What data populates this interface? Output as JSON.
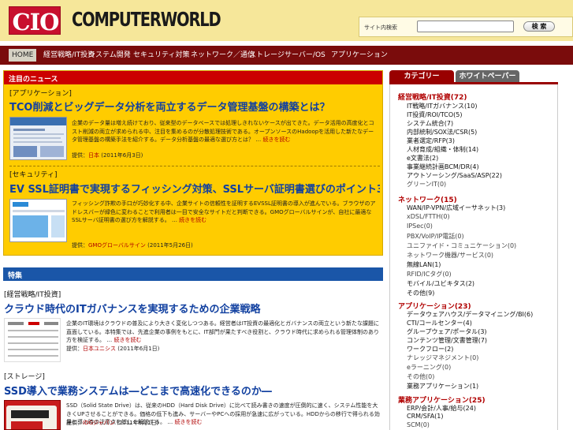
{
  "header": {
    "logo_cio": "CIO",
    "logo_cw": "COMPUTERWORLD",
    "search_label": "サイト内検索",
    "search_placeholder": "",
    "search_button": "検 索"
  },
  "nav": {
    "items": [
      "HOME",
      "経営戦略/IT投資",
      "システム開発",
      "セキュリティ対策",
      "ネットワーク／通信",
      "ストレージ",
      "サーバー/OS",
      "アプリケーション"
    ]
  },
  "featured": {
    "heading": "注目のニュース",
    "articles": [
      {
        "category": "[アプリケーション]",
        "title": "TCO削減とビッグデータ分析を両立するデータ管理基盤の構築とは？",
        "text": "企業のデータ量は増え続けており、従来型のデータベースでは処理しきれないケースが出てきた。データ活用の高度化とコスト削減の両立が求められる中、注目を集めるのが分散処理技術である。オープンソースのHadoopを活用した新たなデータ管理基盤の構築手法を紹介する。データ分析基盤の最適な選び方とは？",
        "more": "続きを読む",
        "byline_label": "提供：",
        "source": "日本",
        "date": "(2011年6月3日)"
      },
      {
        "category": "[セキュリティ]",
        "title": "EV SSL証明書で実現するフィッシング対策、SSLサーバ証明書選びのポイント3つとは？",
        "text": "フィッシング詐欺の手口が巧妙化する中、企業サイトの信頼性を証明するEVSSL証明書の導入が進んでいる。ブラウザのアドレスバーが緑色に変わることで利用者は一目で安全なサイトだと判断できる。GMOグローバルサインが、自社に最適なSSLサーバ証明書の選び方を解説する。",
        "more": "続きを読む",
        "byline_label": "提供：",
        "source": "GMOグローバルサイン",
        "date": "(2011年5月26日)"
      }
    ]
  },
  "news": {
    "heading": "特集",
    "articles": [
      {
        "category": "[経営戦略/IT投資]",
        "title": "クラウド時代のITガバナンスを実現するための企業戦略",
        "text": "企業のIT環境はクラウドの普及により大きく変化しつつある。経営者はIT投資の最適化とガバナンスの両立という新たな課題に直面している。本特集では、先進企業の事例をもとに、IT部門が果たすべき役割と、クラウド時代に求められる管理体制のあり方を検証する。",
        "more": "続きを読む",
        "byline_label": "提供：",
        "source": "日本ユニシス",
        "date": "(2011年6月1日)"
      },
      {
        "category": "[ストレージ]",
        "title": "SSD導入で業務システムは―どこまで高速化できるのか―",
        "text": "SSD（Solid State Drive）は、従来のHDD（Hard Disk Drive）に比べて読み書きの速度が圧倒的に速く、システム性能を大きくUPさせることができる。価格の低下も進み、サーバーやPCへの採用が急速に広がっている。HDDからの移行で得られる効果と導入時の注意点を詳しく解説する。",
        "more": "続きを読む",
        "byline_label": "提供：",
        "source": "IDGジャパン",
        "date": "(2011年6月1日)"
      }
    ]
  },
  "sidebar": {
    "tabs": [
      "カテゴリー",
      "ホワイトペーパー"
    ],
    "sections": [
      {
        "title": "経営戦略/IT投資(72)",
        "items": [
          "IT戦略/ITガバナンス(10)",
          "IT投資/ROI/TCO(5)",
          "システム統合(7)",
          "内部統制/SOX法/CSR(5)",
          "業者選定/RFP(3)",
          "人材育成/組織・体制(14)",
          "e文書法(2)",
          "事業継続計画BCM/DR(4)",
          "アウトソーシング/SaaS/ASP(22)",
          "グリーンIT(0)"
        ]
      },
      {
        "title": "ネットワーク(15)",
        "items": [
          "WAN/IP-VPN/広域イーサネット(3)",
          "xDSL/FTTH(0)",
          "IPSec(0)",
          "PBX/VoIP/IP電話(0)",
          "ユニファイド・コミュニケーション(0)",
          "ネットワーク機器/サービス(0)",
          "無線LAN(1)",
          "RFID/ICタグ(0)",
          "モバイル/ユビキタス(2)",
          "その他(9)"
        ]
      },
      {
        "title": "アプリケーション(23)",
        "items": [
          "データウェアハウス/データマイニング/BI(6)",
          "CTI/コールセンター(4)",
          "グループウェア/ポータル(3)",
          "コンテンツ管理/文書管理(7)",
          "ワークフロー(2)",
          "ナレッジマネジメント(0)",
          "eラーニング(0)",
          "その他(0)",
          "業務アプリケーション(1)"
        ]
      },
      {
        "title": "業務アプリケーション(25)",
        "items": [
          "ERP/会計/人事/給与(24)",
          "CRM/SFA(1)",
          "SCM(0)"
        ]
      }
    ]
  },
  "colors": {
    "header_bg": "#f6e79a",
    "nav_bg": "#7a0c0c",
    "featured_bg": "#ffcc00",
    "accent_red": "#cc0000",
    "accent_blue": "#1a56a8",
    "link_blue": "#1140a0"
  }
}
